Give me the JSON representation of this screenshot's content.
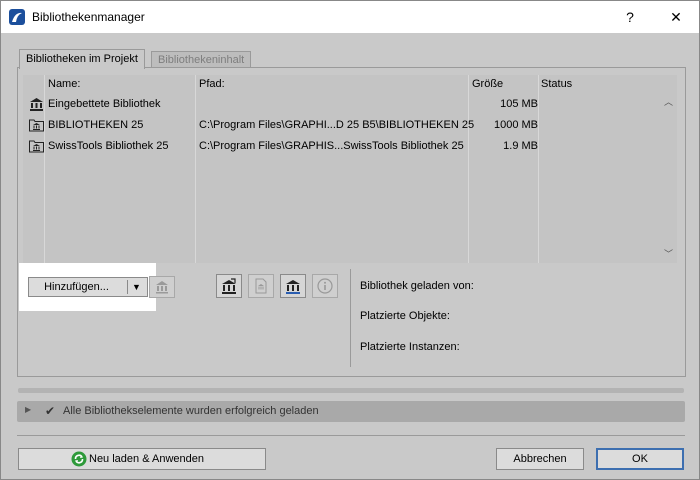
{
  "window": {
    "title": "Bibliothekenmanager",
    "help_label": "?",
    "close_label": "✕"
  },
  "tabs": [
    {
      "label": "Bibliotheken im Projekt",
      "active": true
    },
    {
      "label": "Bibliothekeninhalt",
      "active": false
    }
  ],
  "table": {
    "headers": {
      "name": "Name:",
      "path": "Pfad:",
      "size": "Größe",
      "status": "Status"
    },
    "rows": [
      {
        "icon": "library-icon",
        "name": "Eingebettete Bibliothek",
        "path": "",
        "size": "105 MB"
      },
      {
        "icon": "library-folder-icon",
        "name": "BIBLIOTHEKEN 25",
        "path": "C:\\Program Files\\GRAPHI...D 25 B5\\BIBLIOTHEKEN 25",
        "size": "1000 MB"
      },
      {
        "icon": "library-folder-icon",
        "name": "SwissTools Bibliothek 25",
        "path": "C:\\Program Files\\GRAPHIS...SwissTools Bibliothek 25",
        "size": "1.9 MB"
      }
    ]
  },
  "toolbar": {
    "add_label": "Hinzufügen...",
    "dropdown_arrow": "▼"
  },
  "info": {
    "loaded_from_label": "Bibliothek geladen von:",
    "placed_objects_label": "Platzierte Objekte:",
    "placed_instances_label": "Platzierte Instanzen:"
  },
  "status": {
    "message": "Alle Bibliothekselemente wurden erfolgreich geladen"
  },
  "buttons": {
    "reload_label": "Neu laden & Anwenden",
    "cancel_label": "Abbrechen",
    "ok_label": "OK"
  },
  "colors": {
    "dialog_bg": "#c9c9c9",
    "ok_border": "#3d6fb0",
    "reload_icon": "#2e9a3a"
  }
}
